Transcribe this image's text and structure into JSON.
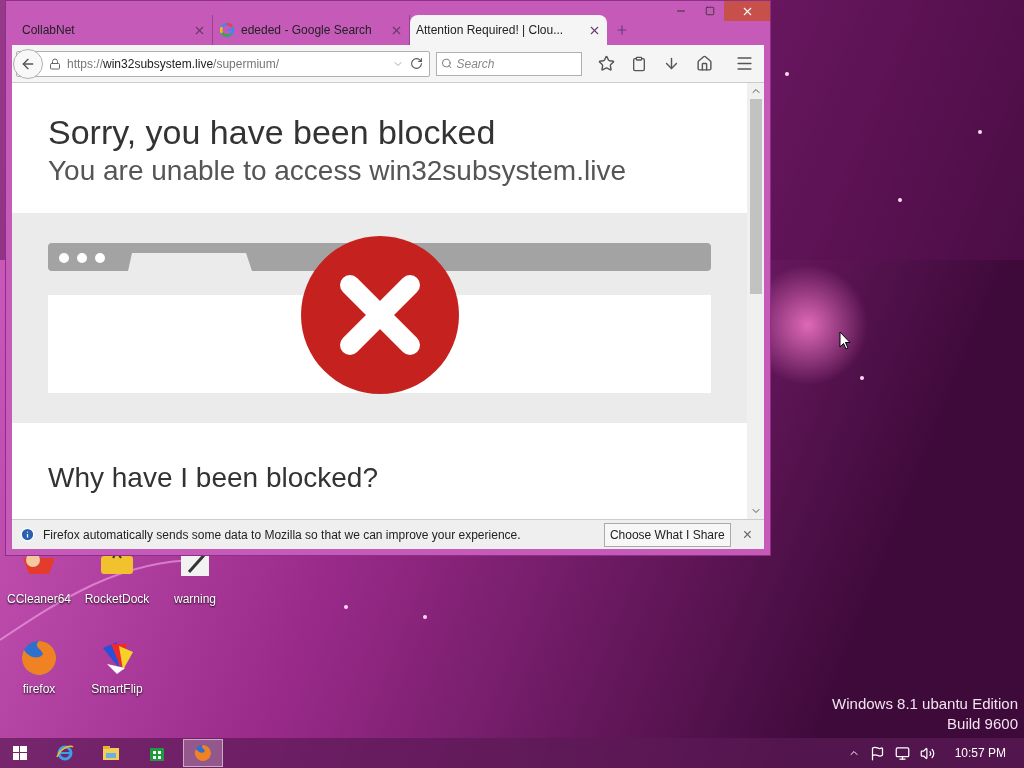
{
  "tabs": [
    {
      "title": "CollabNet",
      "has_favicon": false,
      "selected": false
    },
    {
      "title": "ededed - Google Search",
      "has_favicon": true,
      "selected": false
    },
    {
      "title": "Attention Required! | Clou...",
      "has_favicon": false,
      "selected": true
    }
  ],
  "address_bar": {
    "scheme": "https://",
    "domain": "win32subsystem.live",
    "path": "/supermium/"
  },
  "search": {
    "placeholder": "Search"
  },
  "page": {
    "title": "Sorry, you have been blocked",
    "subtitle": "You are unable to access win32subsystem.live",
    "section_heading": "Why have I been blocked?"
  },
  "notification": {
    "message": "Firefox automatically sends some data to Mozilla so that we can improve your experience.",
    "button": "Choose What I Share",
    "close": "×"
  },
  "desktop_icons": [
    {
      "label": "CCleaner64",
      "kind": "cleaner"
    },
    {
      "label": "RocketDock",
      "kind": "dock"
    },
    {
      "label": "warning",
      "kind": "note"
    },
    {
      "label": "firefox",
      "kind": "firefox"
    },
    {
      "label": "SmartFlip",
      "kind": "flip"
    }
  ],
  "edition_text": [
    "Windows 8.1 ubantu Edition",
    "Build 9600"
  ],
  "taskbar": {
    "apps": [
      {
        "kind": "ie",
        "selected": false
      },
      {
        "kind": "explorer",
        "selected": false
      },
      {
        "kind": "store",
        "selected": false
      },
      {
        "kind": "firefox",
        "selected": true
      }
    ],
    "clock": "10:57 PM"
  }
}
